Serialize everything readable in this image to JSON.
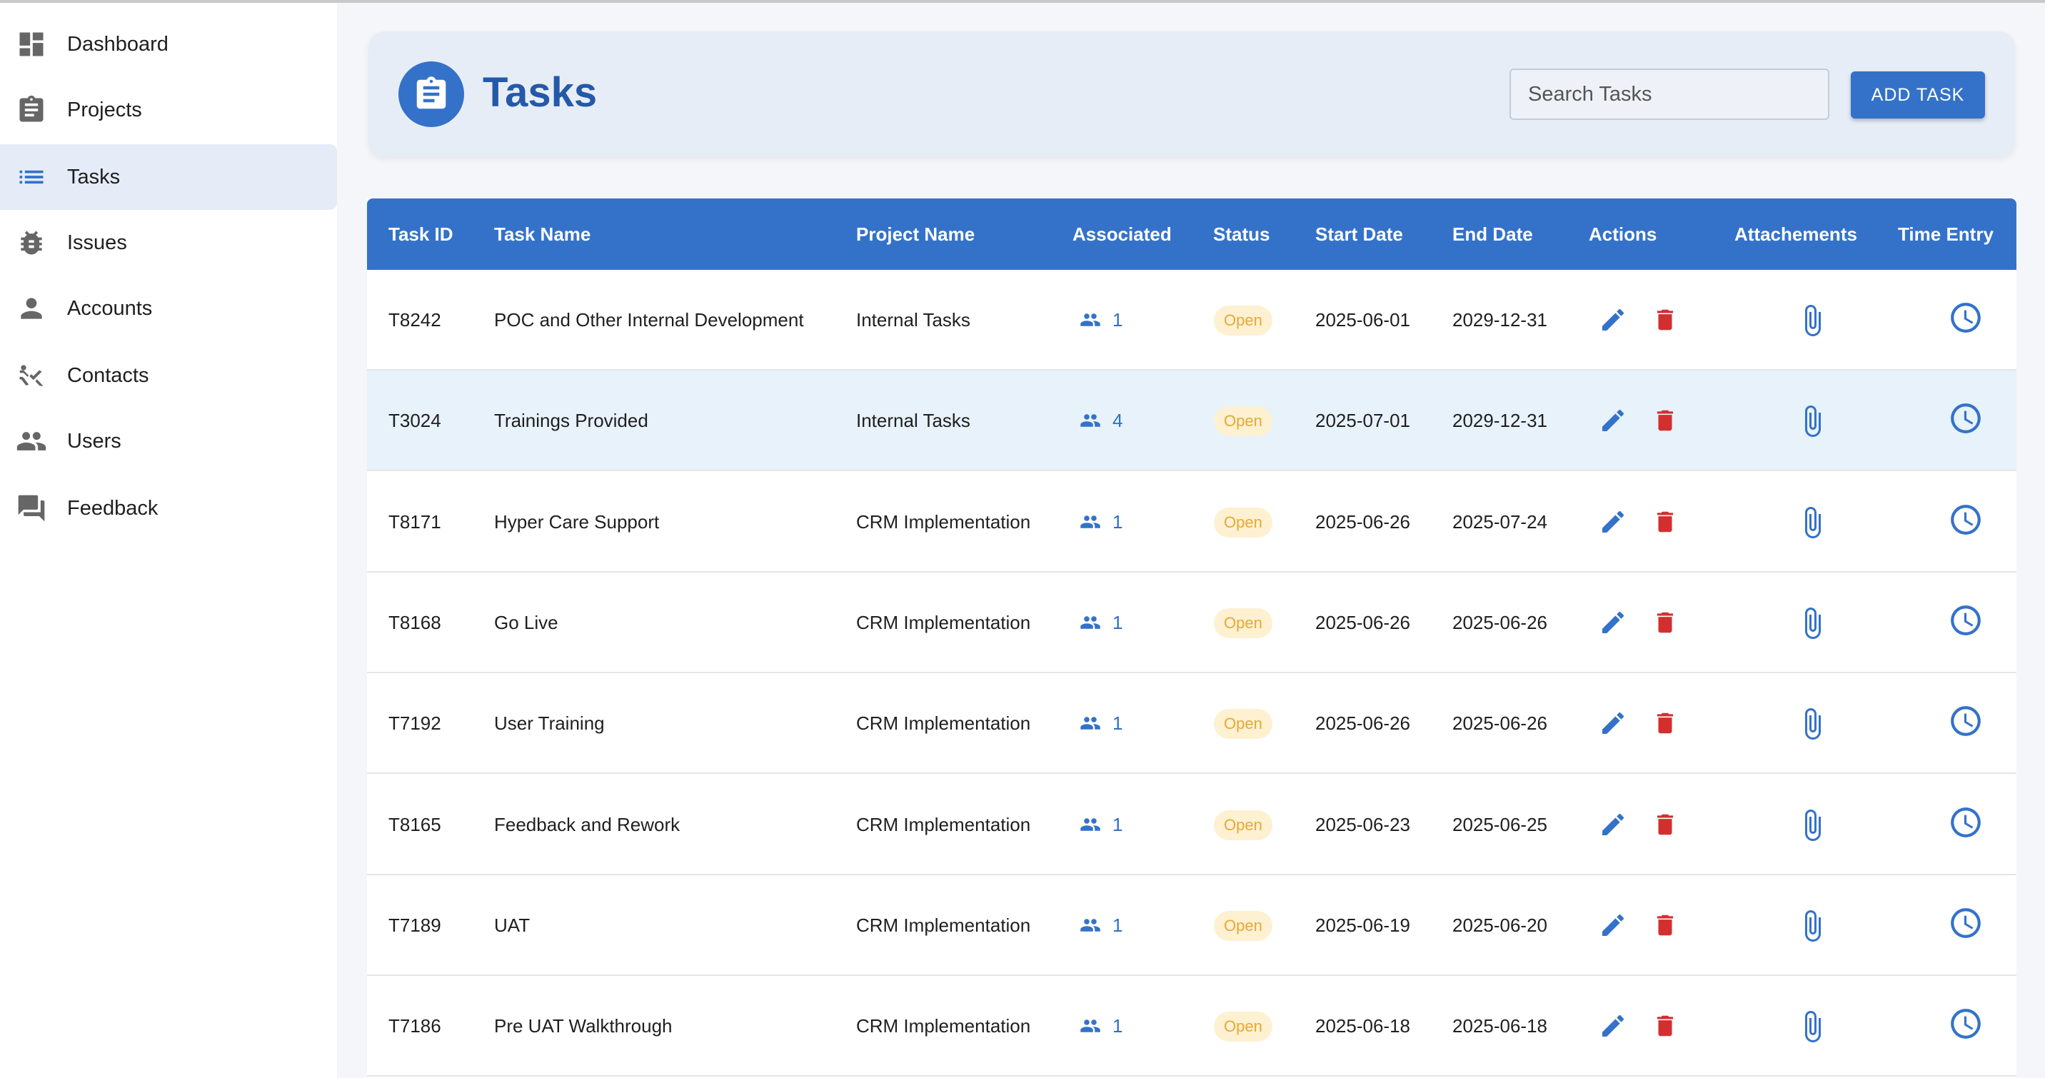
{
  "sidebar": {
    "items": [
      {
        "label": "Dashboard",
        "icon": "dashboard-icon",
        "active": false
      },
      {
        "label": "Projects",
        "icon": "clipboard-icon",
        "active": false
      },
      {
        "label": "Tasks",
        "icon": "list-icon",
        "active": true
      },
      {
        "label": "Issues",
        "icon": "bug-icon",
        "active": false
      },
      {
        "label": "Accounts",
        "icon": "person-icon",
        "active": false
      },
      {
        "label": "Contacts",
        "icon": "contacts-icon",
        "active": false
      },
      {
        "label": "Users",
        "icon": "people-icon",
        "active": false
      },
      {
        "label": "Feedback",
        "icon": "chat-icon",
        "active": false
      }
    ]
  },
  "header": {
    "title": "Tasks",
    "search_placeholder": "Search Tasks",
    "add_button": "ADD TASK"
  },
  "table": {
    "columns": [
      "Task ID",
      "Task Name",
      "Project Name",
      "Associated",
      "Status",
      "Start Date",
      "End Date",
      "Actions",
      "Attachements",
      "Time Entry"
    ],
    "rows": [
      {
        "id": "T8242",
        "name": "POC and Other Internal Development",
        "project": "Internal Tasks",
        "associated": "1",
        "status": "Open",
        "start": "2025-06-01",
        "end": "2029-12-31"
      },
      {
        "id": "T3024",
        "name": "Trainings Provided",
        "project": "Internal Tasks",
        "associated": "4",
        "status": "Open",
        "start": "2025-07-01",
        "end": "2029-12-31"
      },
      {
        "id": "T8171",
        "name": "Hyper Care Support",
        "project": "CRM Implementation",
        "associated": "1",
        "status": "Open",
        "start": "2025-06-26",
        "end": "2025-07-24"
      },
      {
        "id": "T8168",
        "name": "Go Live",
        "project": "CRM Implementation",
        "associated": "1",
        "status": "Open",
        "start": "2025-06-26",
        "end": "2025-06-26"
      },
      {
        "id": "T7192",
        "name": "User Training",
        "project": "CRM Implementation",
        "associated": "1",
        "status": "Open",
        "start": "2025-06-26",
        "end": "2025-06-26"
      },
      {
        "id": "T8165",
        "name": "Feedback and Rework",
        "project": "CRM Implementation",
        "associated": "1",
        "status": "Open",
        "start": "2025-06-23",
        "end": "2025-06-25"
      },
      {
        "id": "T7189",
        "name": "UAT",
        "project": "CRM Implementation",
        "associated": "1",
        "status": "Open",
        "start": "2025-06-19",
        "end": "2025-06-20"
      },
      {
        "id": "T7186",
        "name": "Pre UAT Walkthrough",
        "project": "CRM Implementation",
        "associated": "1",
        "status": "Open",
        "start": "2025-06-18",
        "end": "2025-06-18"
      }
    ]
  },
  "colors": {
    "primary": "#3472c9",
    "title": "#2359a8",
    "delete": "#d32f2f",
    "badge_bg": "#fdf1d2",
    "badge_text": "#e8a835",
    "highlight_row": "#e7f2fb",
    "active_nav": "#e5ecf7"
  }
}
